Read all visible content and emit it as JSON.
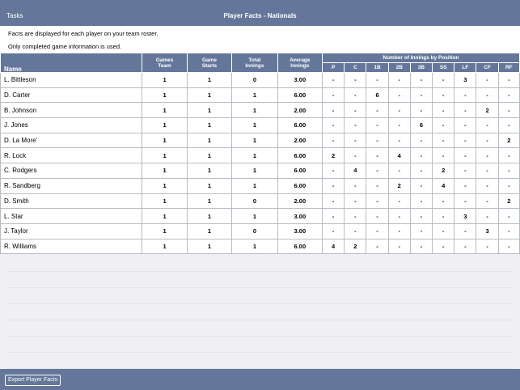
{
  "topbar": {
    "tasks_label": "Tasks",
    "title": "Player Facts - Nationals"
  },
  "info": {
    "line1": "Facts are displayed for each player on your team roster.",
    "line2": "Only completed game information is used."
  },
  "table": {
    "name_header": "Name",
    "stat_headers": [
      {
        "line1": "Games",
        "line2": "Team"
      },
      {
        "line1": "Game",
        "line2": "Starts"
      },
      {
        "line1": "Total",
        "line2": "Innings"
      },
      {
        "line1": "Average",
        "line2": "Innings"
      }
    ],
    "group_header": "Number of Innings by Position",
    "positions": [
      "P",
      "C",
      "1B",
      "2B",
      "3B",
      "SS",
      "LF",
      "CF",
      "RF"
    ],
    "rows": [
      {
        "name": "L. Bittleson",
        "games": "1",
        "starts": "1",
        "total": "0",
        "avg": "3.00",
        "pos": [
          "-",
          "-",
          "-",
          "-",
          "-",
          "-",
          "3",
          "-",
          "-"
        ]
      },
      {
        "name": "D. Carter",
        "games": "1",
        "starts": "1",
        "total": "1",
        "avg": "6.00",
        "pos": [
          "-",
          "-",
          "6",
          "-",
          "-",
          "-",
          "-",
          "-",
          "-"
        ]
      },
      {
        "name": "B. Johnson",
        "games": "1",
        "starts": "1",
        "total": "1",
        "avg": "2.00",
        "pos": [
          "-",
          "-",
          "-",
          "-",
          "-",
          "-",
          "-",
          "2",
          "-"
        ]
      },
      {
        "name": "J. Jones",
        "games": "1",
        "starts": "1",
        "total": "1",
        "avg": "6.00",
        "pos": [
          "-",
          "-",
          "-",
          "-",
          "6",
          "-",
          "-",
          "-",
          "-"
        ]
      },
      {
        "name": "D. La More'",
        "games": "1",
        "starts": "1",
        "total": "1",
        "avg": "2.00",
        "pos": [
          "-",
          "-",
          "-",
          "-",
          "-",
          "-",
          "-",
          "-",
          "2"
        ]
      },
      {
        "name": "R. Lock",
        "games": "1",
        "starts": "1",
        "total": "1",
        "avg": "6.00",
        "pos": [
          "2",
          "-",
          "-",
          "4",
          "-",
          "-",
          "-",
          "-",
          "-"
        ]
      },
      {
        "name": "C. Rodgers",
        "games": "1",
        "starts": "1",
        "total": "1",
        "avg": "6.00",
        "pos": [
          "-",
          "4",
          "-",
          "-",
          "-",
          "2",
          "-",
          "-",
          "-"
        ]
      },
      {
        "name": "R. Sandberg",
        "games": "1",
        "starts": "1",
        "total": "1",
        "avg": "6.00",
        "pos": [
          "-",
          "-",
          "-",
          "2",
          "-",
          "4",
          "-",
          "-",
          "-"
        ]
      },
      {
        "name": "D. Smith",
        "games": "1",
        "starts": "1",
        "total": "0",
        "avg": "2.00",
        "pos": [
          "-",
          "-",
          "-",
          "-",
          "-",
          "-",
          "-",
          "-",
          "2"
        ]
      },
      {
        "name": "L. Star",
        "games": "1",
        "starts": "1",
        "total": "1",
        "avg": "3.00",
        "pos": [
          "-",
          "-",
          "-",
          "-",
          "-",
          "-",
          "3",
          "-",
          "-"
        ]
      },
      {
        "name": "J. Taylor",
        "games": "1",
        "starts": "1",
        "total": "0",
        "avg": "3.00",
        "pos": [
          "-",
          "-",
          "-",
          "-",
          "-",
          "-",
          "-",
          "3",
          "-"
        ]
      },
      {
        "name": "R. Williams",
        "games": "1",
        "starts": "1",
        "total": "1",
        "avg": "6.00",
        "pos": [
          "4",
          "2",
          "-",
          "-",
          "-",
          "-",
          "-",
          "-",
          "-"
        ]
      }
    ]
  },
  "bottombar": {
    "export_label": "Export Player Facts"
  },
  "colors": {
    "bar": "#64779a",
    "background": "#efeff4",
    "grid": "#b8bcc5"
  }
}
